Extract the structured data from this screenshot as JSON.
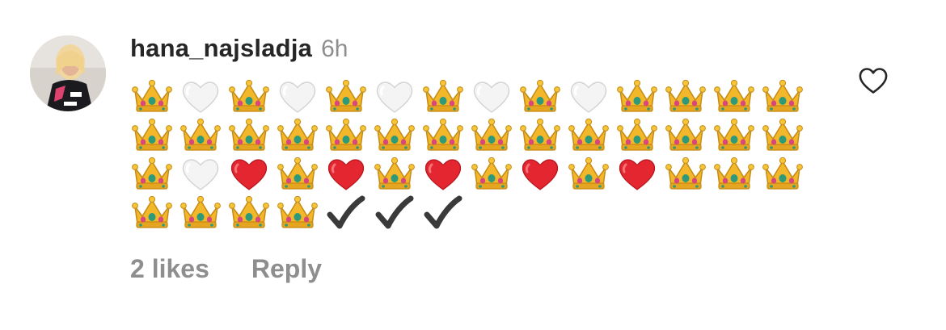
{
  "comment": {
    "username": "hana_najsladja",
    "timestamp": "6h",
    "emoji_rows": [
      [
        "crown",
        "white-heart",
        "crown",
        "white-heart",
        "crown",
        "white-heart",
        "crown",
        "white-heart",
        "crown",
        "white-heart",
        "crown",
        "crown",
        "crown",
        "crown"
      ],
      [
        "crown",
        "crown",
        "crown",
        "crown",
        "crown",
        "crown",
        "crown",
        "crown",
        "crown",
        "crown",
        "crown",
        "crown",
        "crown",
        "crown"
      ],
      [
        "crown",
        "white-heart",
        "red-heart",
        "crown",
        "red-heart",
        "crown",
        "red-heart",
        "crown",
        "red-heart",
        "crown",
        "red-heart",
        "crown",
        "crown",
        "crown"
      ],
      [
        "crown",
        "crown",
        "crown",
        "crown",
        "check",
        "check",
        "check"
      ]
    ],
    "likes_label": "2 likes",
    "reply_label": "Reply",
    "like_icon": "heart-outline-icon"
  },
  "colors": {
    "username": "#262626",
    "secondary": "#8e8e8e",
    "crown_gold": "#f2b72a",
    "red_heart": "#e3262f",
    "check": "#3a3a3a"
  }
}
